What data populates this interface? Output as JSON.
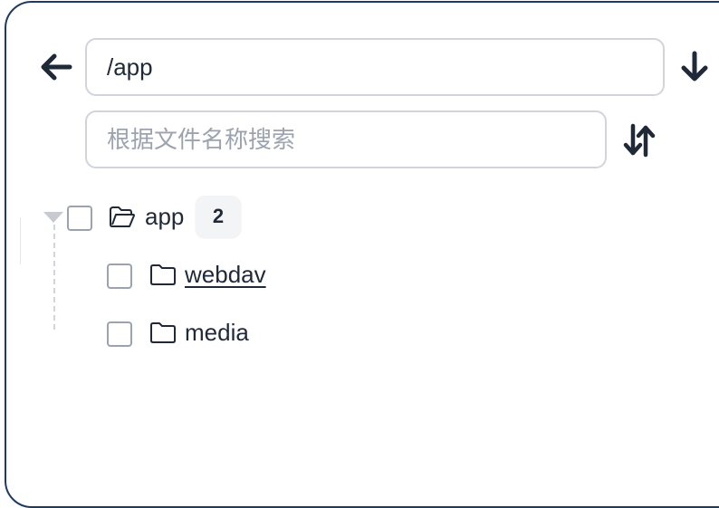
{
  "toolbar": {
    "back_icon": "arrow-left-icon",
    "download_icon": "arrow-down-icon",
    "sort_icon": "sort-arrows-icon"
  },
  "path": {
    "value": "/app"
  },
  "search": {
    "placeholder": "根据文件名称搜索",
    "value": ""
  },
  "tree": {
    "root": {
      "label": "app",
      "count": "2",
      "expanded": true,
      "icon": "folder-open-icon"
    },
    "children": [
      {
        "label": "webdav",
        "icon": "folder-icon",
        "underlined": true
      },
      {
        "label": "media",
        "icon": "folder-icon",
        "underlined": false
      }
    ]
  },
  "colors": {
    "border_accent": "#1f3a5f",
    "text": "#1f2937",
    "placeholder": "#9ca3af"
  }
}
